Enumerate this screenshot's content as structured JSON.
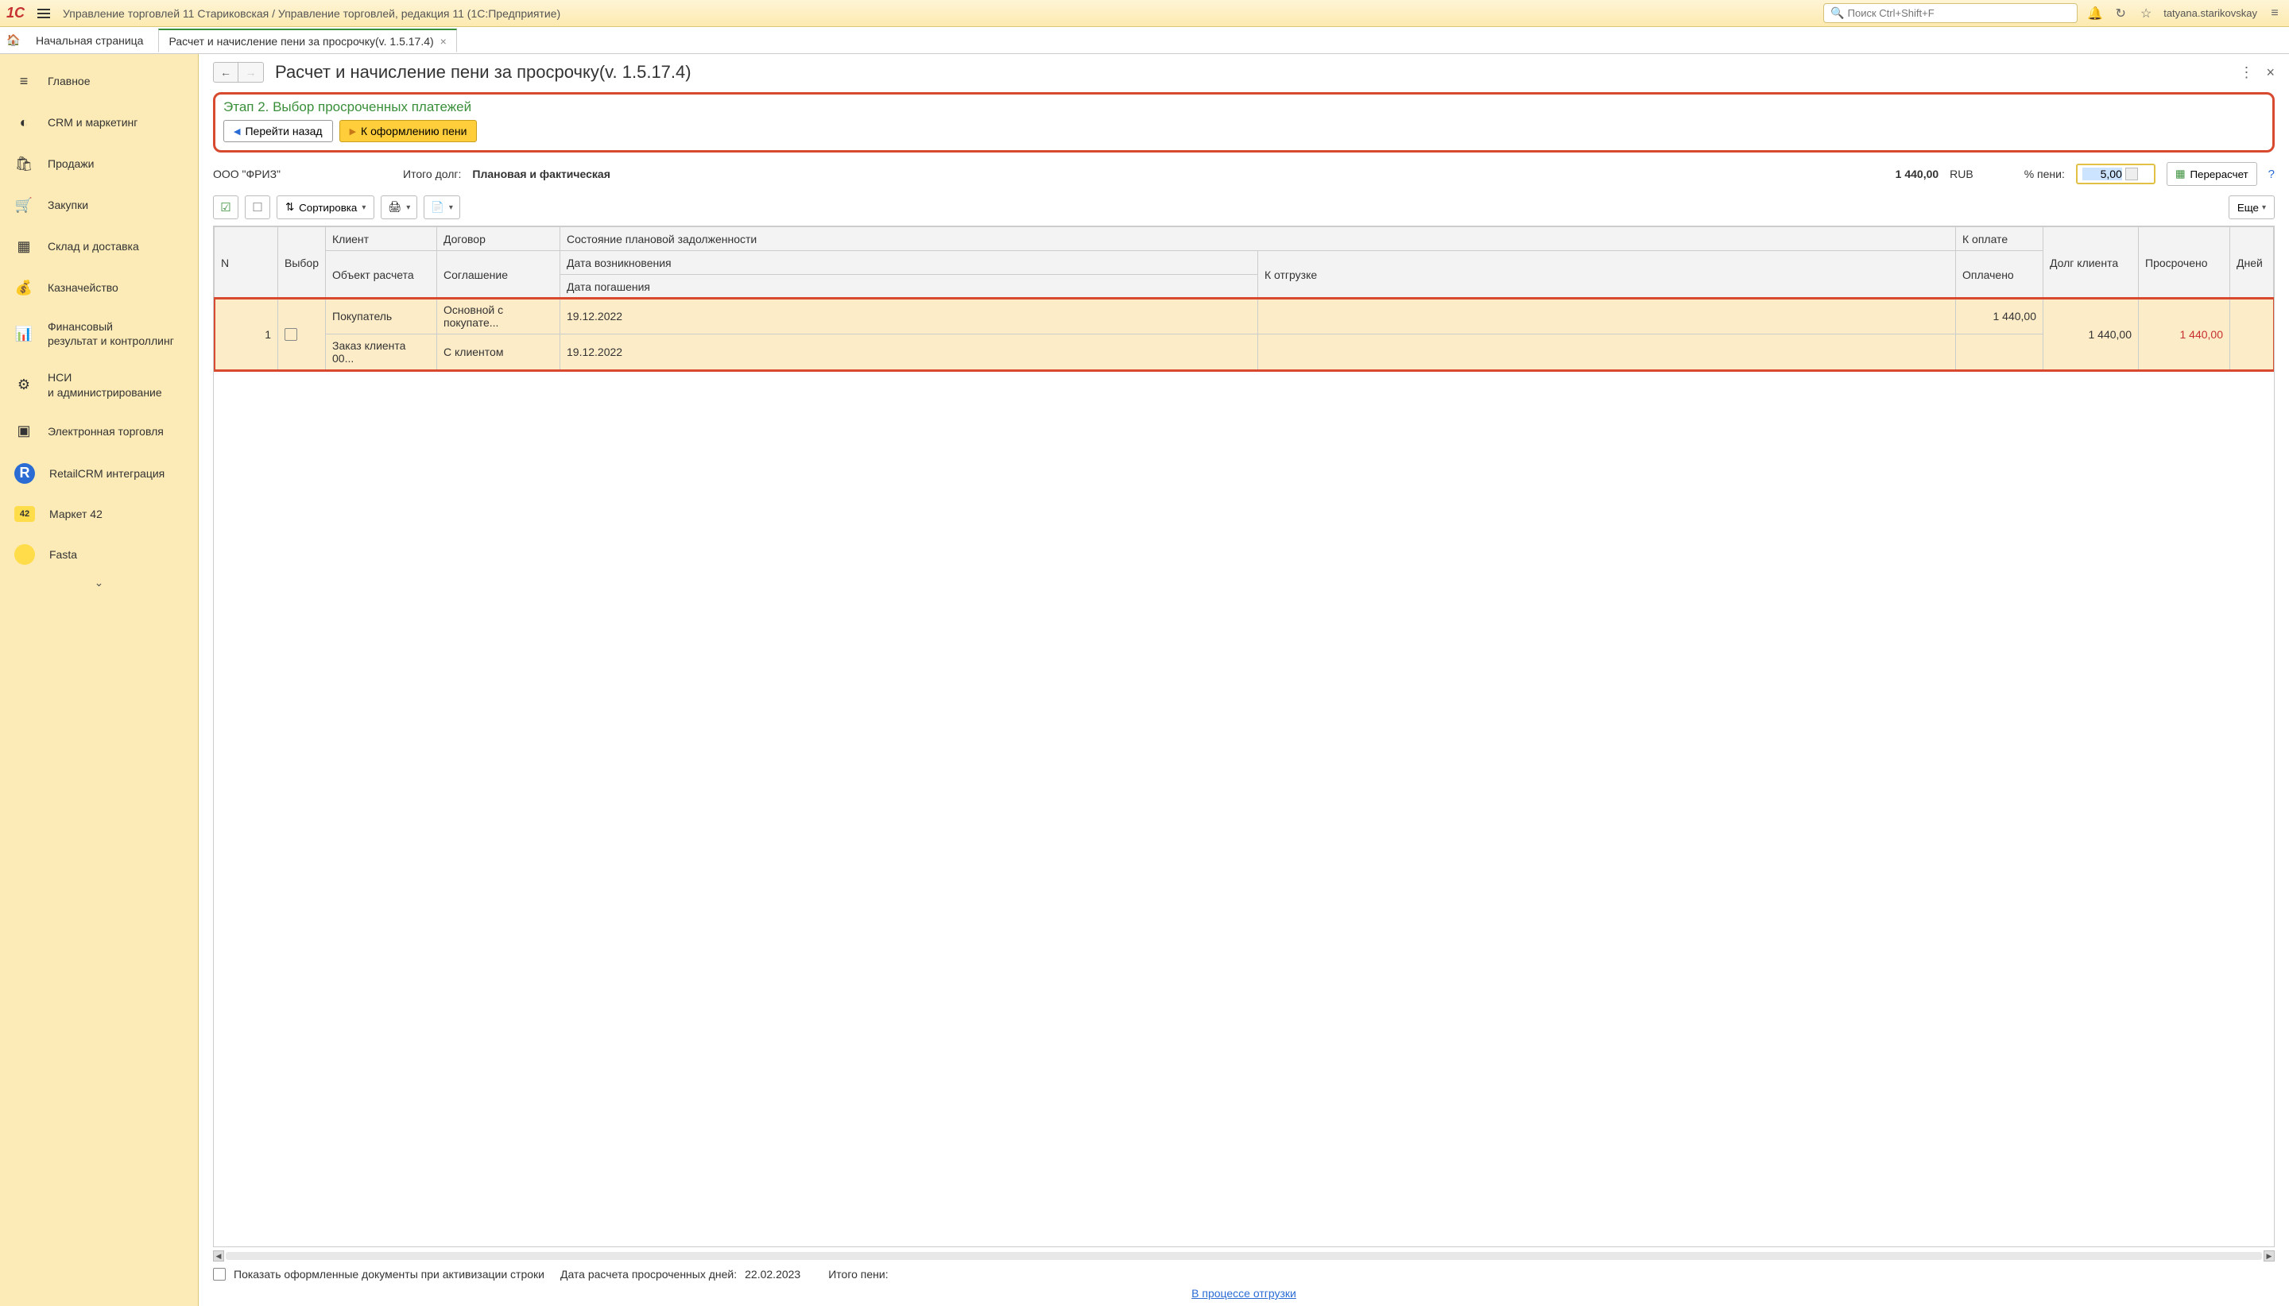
{
  "app_title": "Управление торговлей 11 Стариковская / Управление торговлей, редакция 11  (1С:Предприятие)",
  "search_placeholder": "Поиск Ctrl+Shift+F",
  "user": "tatyana.starikovskay",
  "tabs": {
    "home": "Начальная страница",
    "active": "Расчет и начисление пени за просрочку(v. 1.5.17.4)"
  },
  "sidebar": [
    {
      "label": "Главное"
    },
    {
      "label": "CRM и маркетинг"
    },
    {
      "label": "Продажи"
    },
    {
      "label": "Закупки"
    },
    {
      "label": "Склад и доставка"
    },
    {
      "label": "Казначейство"
    },
    {
      "label": "Финансовый\nрезультат и контроллинг"
    },
    {
      "label": "НСИ\nи администрирование"
    },
    {
      "label": "Электронная торговля"
    },
    {
      "label": "RetailCRM интеграция"
    },
    {
      "label": "Маркет 42"
    },
    {
      "label": "Fasta"
    }
  ],
  "page": {
    "title": "Расчет и начисление пени за просрочку(v. 1.5.17.4)",
    "step_title": "Этап 2. Выбор просроченных платежей",
    "back_btn": "Перейти назад",
    "next_btn": "К оформлению  пени",
    "company": "ООО \"ФРИЗ\"",
    "total_debt_label": "Итого долг:",
    "debt_type": "Плановая и фактическая",
    "total_amount": "1 440,00",
    "currency": "RUB",
    "pct_label": "% пени:",
    "pct_value": "5,00",
    "recalc": "Перерасчет",
    "sort": "Сортировка",
    "more": "Еще"
  },
  "table": {
    "headers": {
      "n": "N",
      "select": "Выбор",
      "client": "Клиент",
      "contract": "Договор",
      "status": "Состояние плановой задолженности",
      "calc_obj": "Объект расчета",
      "agreement": "Соглашение",
      "date_occur": "Дата возникновения",
      "date_pay": "Дата погашения",
      "to_ship": "К отгрузке",
      "to_pay": "К оплате",
      "paid": "Оплачено",
      "client_debt": "Долг клиента",
      "overdue": "Просрочено",
      "days": "Дней"
    },
    "rows": [
      {
        "n": "1",
        "client": "Покупатель",
        "contract": "Основной с покупате...",
        "date_occur": "19.12.2022",
        "to_pay": "1 440,00",
        "client_debt": "1 440,00",
        "overdue": "1 440,00",
        "calc_obj": "Заказ клиента 00...",
        "agreement": "С клиентом",
        "date_pay": "19.12.2022"
      }
    ]
  },
  "footer": {
    "show_docs": "Показать  оформленные документы  при активизации строки",
    "calc_date_label": "Дата расчета   просроченных дней:",
    "calc_date": "22.02.2023",
    "total_penalty": "Итого пени:",
    "shipping_link": "В процессе отгрузки"
  }
}
